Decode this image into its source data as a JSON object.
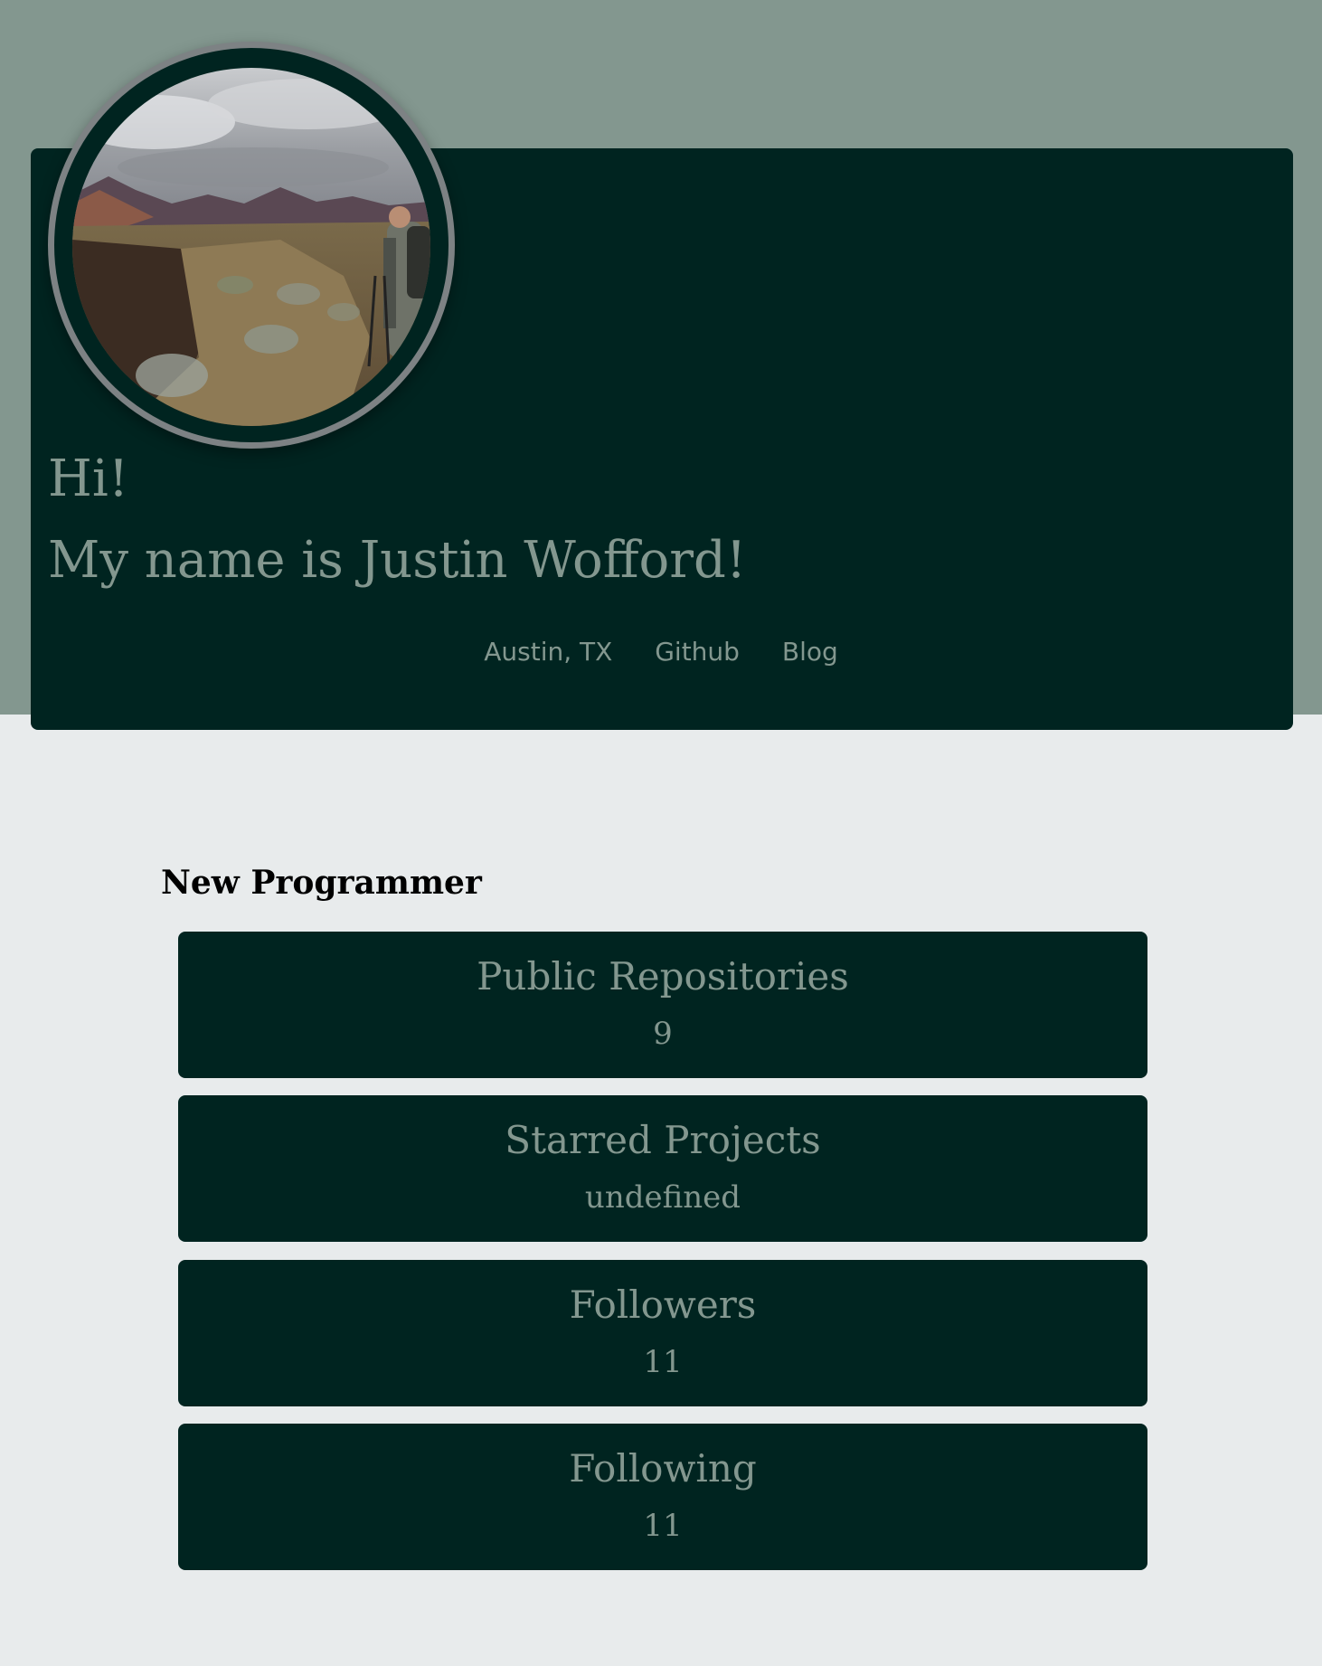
{
  "header": {
    "greeting": "Hi!",
    "name_line": "My name is Justin Wofford!",
    "links": {
      "location": "Austin, TX",
      "github": "Github",
      "blog": "Blog"
    }
  },
  "profile": {
    "title": "New Programmer",
    "stats": [
      {
        "label": "Public Repositories",
        "value": "9"
      },
      {
        "label": "Starred Projects",
        "value": "undefined"
      },
      {
        "label": "Followers",
        "value": "11"
      },
      {
        "label": "Following",
        "value": "11"
      }
    ]
  },
  "colors": {
    "page_background": "#e8ebec",
    "band": "#83978f",
    "card": "#002420",
    "text_muted": "#83978f",
    "ring": "#7d8284"
  }
}
